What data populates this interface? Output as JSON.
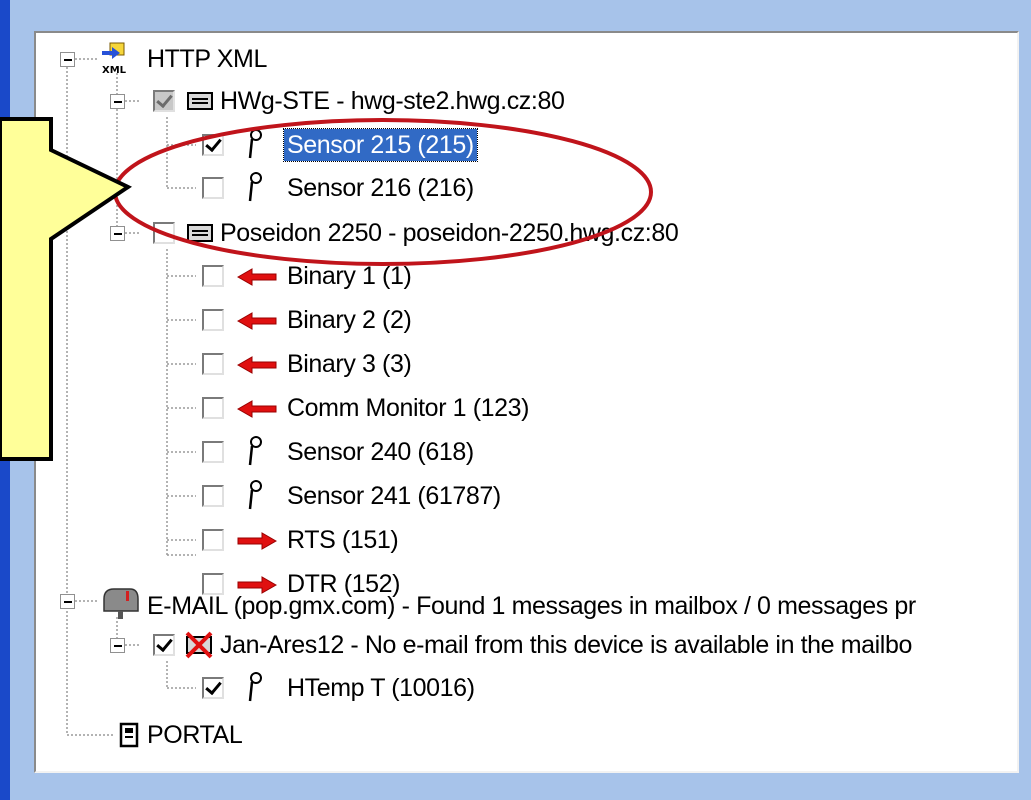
{
  "tree": {
    "http_xml": {
      "label": "HTTP XML"
    },
    "hwg_ste": {
      "label": "HWg-STE - hwg-ste2.hwg.cz:80"
    },
    "sensor_215": {
      "label": "Sensor 215 (215)"
    },
    "sensor_216": {
      "label": "Sensor 216 (216)"
    },
    "poseidon": {
      "label": "Poseidon 2250 - poseidon-2250.hwg.cz:80"
    },
    "binary_1": {
      "label": "Binary 1 (1)"
    },
    "binary_2": {
      "label": "Binary 2 (2)"
    },
    "binary_3": {
      "label": "Binary 3 (3)"
    },
    "comm_monitor": {
      "label": "Comm Monitor 1 (123)"
    },
    "sensor_240": {
      "label": "Sensor 240 (618)"
    },
    "sensor_241": {
      "label": "Sensor 241 (61787)"
    },
    "rts": {
      "label": "RTS (151)"
    },
    "dtr": {
      "label": "DTR (152)"
    },
    "email": {
      "label": "E-MAIL (pop.gmx.com) - Found 1 messages in mailbox / 0 messages pr"
    },
    "jan_ares": {
      "label": "Jan-Ares12 - No e-mail from this device is available in the mailbo"
    },
    "htemp": {
      "label": "HTemp T (10016)"
    },
    "portal": {
      "label": "PORTAL"
    }
  },
  "colors": {
    "selection": "#316ac5",
    "highlight_ellipse": "#c0141b",
    "callout_fill": "#ffff99",
    "arrow_red": "#e01010"
  }
}
